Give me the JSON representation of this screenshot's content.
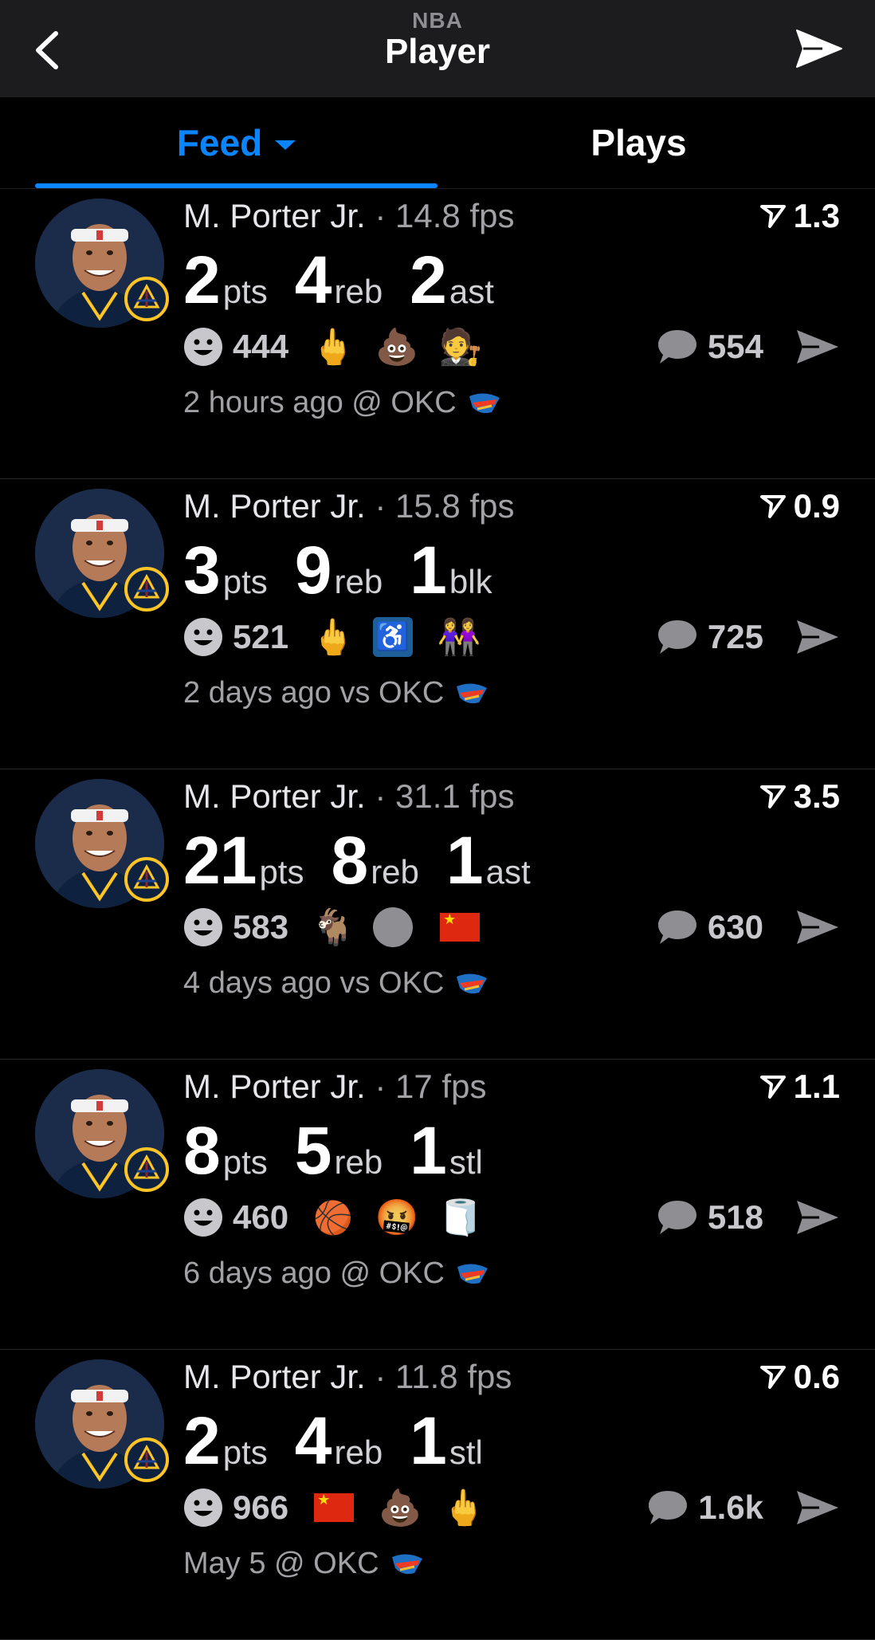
{
  "header": {
    "league": "NBA",
    "title": "Player"
  },
  "tabs": [
    {
      "label": "Feed"
    },
    {
      "label": "Plays"
    }
  ],
  "posts": [
    {
      "player": "M. Porter Jr.",
      "fps": "· 14.8 fps",
      "vote": "1.3",
      "stats": [
        {
          "value": "2",
          "label": "pts"
        },
        {
          "value": "4",
          "label": "reb"
        },
        {
          "value": "2",
          "label": "ast"
        }
      ],
      "likes": "444",
      "reactions": [
        "middle-finger",
        "poop",
        "referee"
      ],
      "comments": "554",
      "time": "2 hours ago @ OKC"
    },
    {
      "player": "M. Porter Jr.",
      "fps": "· 15.8 fps",
      "vote": "0.9",
      "stats": [
        {
          "value": "3",
          "label": "pts"
        },
        {
          "value": "9",
          "label": "reb"
        },
        {
          "value": "1",
          "label": "blk"
        }
      ],
      "likes": "521",
      "reactions": [
        "middle-finger",
        "wheelchair",
        "two-women"
      ],
      "comments": "725",
      "time": "2 days ago vs OKC"
    },
    {
      "player": "M. Porter Jr.",
      "fps": "· 31.1 fps",
      "vote": "3.5",
      "stats": [
        {
          "value": "21",
          "label": "pts"
        },
        {
          "value": "8",
          "label": "reb"
        },
        {
          "value": "1",
          "label": "ast"
        }
      ],
      "likes": "583",
      "reactions": [
        "goat",
        "grey-circle",
        "china-flag"
      ],
      "comments": "630",
      "time": "4 days ago vs OKC"
    },
    {
      "player": "M. Porter Jr.",
      "fps": "· 17 fps",
      "vote": "1.1",
      "stats": [
        {
          "value": "8",
          "label": "pts"
        },
        {
          "value": "5",
          "label": "reb"
        },
        {
          "value": "1",
          "label": "stl"
        }
      ],
      "likes": "460",
      "reactions": [
        "basketball-hoop",
        "cursing-face",
        "toilet-paper"
      ],
      "comments": "518",
      "time": "6 days ago @ OKC"
    },
    {
      "player": "M. Porter Jr.",
      "fps": "· 11.8 fps",
      "vote": "0.6",
      "stats": [
        {
          "value": "2",
          "label": "pts"
        },
        {
          "value": "4",
          "label": "reb"
        },
        {
          "value": "1",
          "label": "stl"
        }
      ],
      "likes": "966",
      "reactions": [
        "china-flag",
        "poop",
        "middle-finger"
      ],
      "comments": "1.6k",
      "time": "May 5 @ OKC"
    }
  ],
  "colors": {
    "accent": "#0a84ff",
    "background": "#000000",
    "header_bg": "#1c1c1e",
    "team_gold": "#fec524",
    "team_navy": "#0e2240"
  }
}
